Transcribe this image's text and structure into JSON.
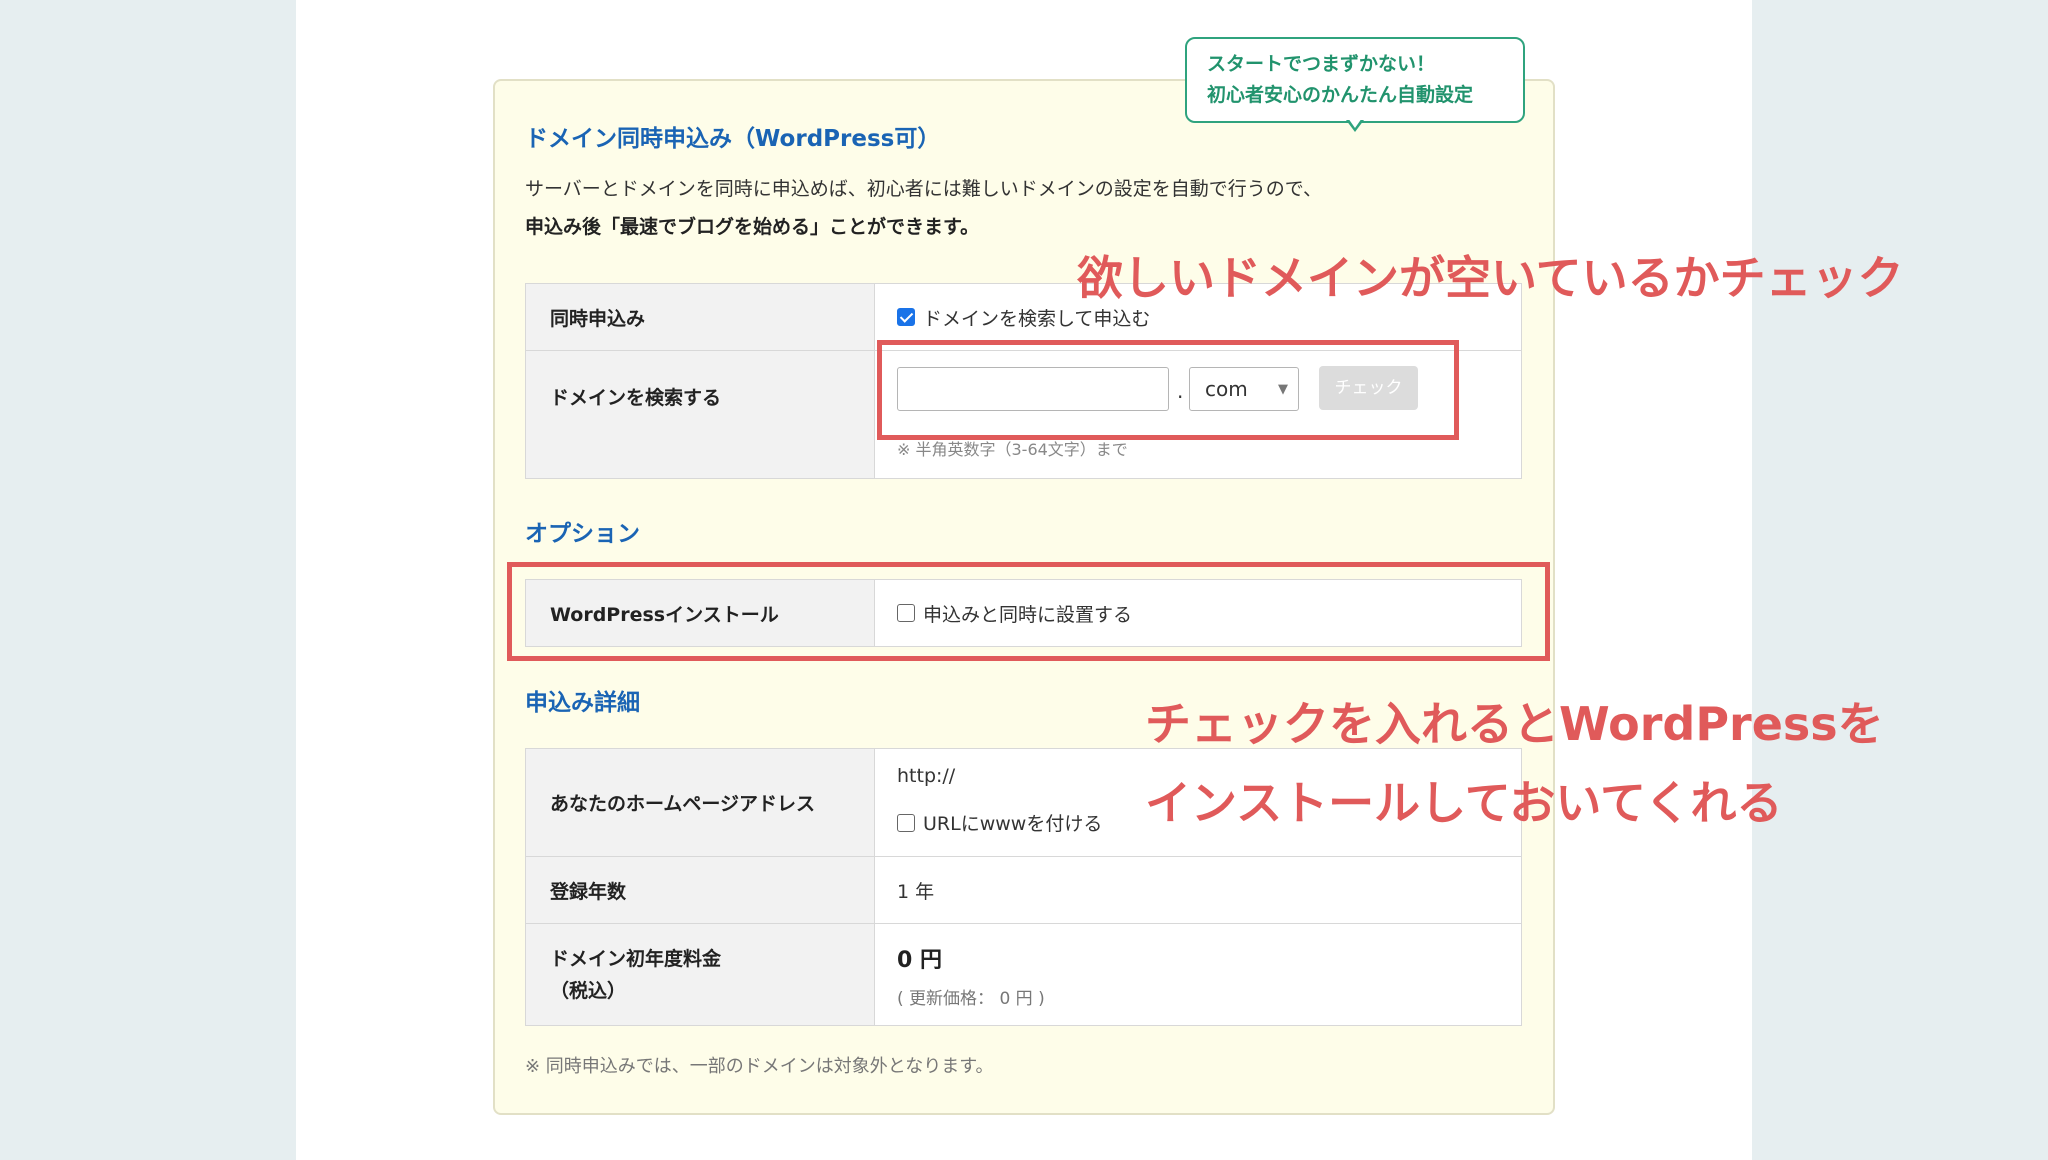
{
  "bubble": {
    "line1": "スタートでつまずかない！",
    "line2": "初心者安心のかんたん自動設定"
  },
  "section_title": "ドメイン同時申込み（WordPress可）",
  "intro": {
    "line1": "サーバーとドメインを同時に申込めば、初心者には難しいドメインの設定を自動で行うので、",
    "line2": "申込み後「最速でブログを始める」ことができます。"
  },
  "domain_table": {
    "simultaneous_label": "同時申込み",
    "simultaneous_checkbox_label": "ドメインを検索して申込む",
    "simultaneous_checked": true,
    "search_label": "ドメインを検索する",
    "domain_input_value": "",
    "dot": ".",
    "tld_selected": "com",
    "check_button": "チェック",
    "hint": "※ 半角英数字（3-64文字）まで"
  },
  "options": {
    "title": "オプション",
    "wp_label": "WordPressインストール",
    "wp_checkbox_label": "申込みと同時に設置する",
    "wp_checked": false
  },
  "details": {
    "title": "申込み詳細",
    "address_label": "あなたのホームページアドレス",
    "address_value": "http://",
    "www_checkbox_label": "URLにwwwを付ける",
    "years_label": "登録年数",
    "years_value": "1 年",
    "fee_label_line1": "ドメイン初年度料金",
    "fee_label_line2": "（税込）",
    "fee_value": "0 円",
    "fee_renewal": "( 更新価格： 0 円 )"
  },
  "footnote": "※ 同時申込みでは、一部のドメインは対象外となります。",
  "annotations": {
    "check_domain": "欲しいドメインが空いているかチェック",
    "wp_line1": "チェックを入れるとWordPressを",
    "wp_line2": "インストールしておいてくれる"
  },
  "colors": {
    "annotation_red": "#e05a5a",
    "heading_blue": "#1a64b4",
    "bubble_green": "#2fa37e",
    "panel_bg": "#fefde9"
  }
}
